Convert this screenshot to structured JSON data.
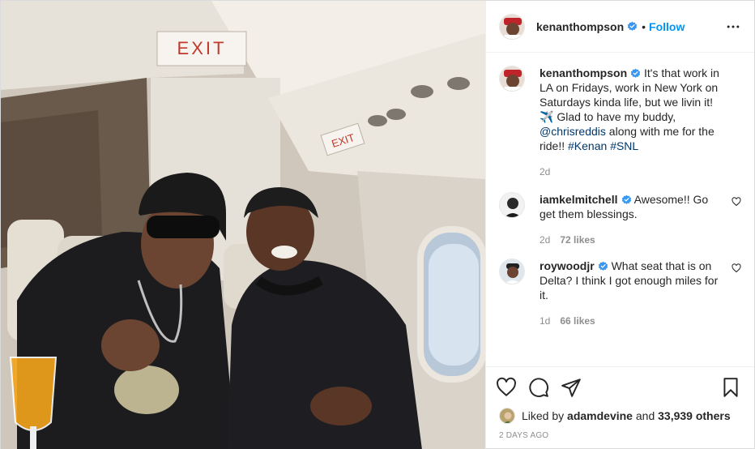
{
  "post": {
    "username": "kenanthompson",
    "follow_label": "Follow",
    "dot": "•"
  },
  "caption": {
    "username": "kenanthompson",
    "text_part1": "It's that work in LA on Fridays, work in New York on Saturdays kinda life, but we livin it! ✈️ Glad to have my buddy,",
    "mention": "@chrisreddis",
    "text_part2": "along with me for the ride!!",
    "hashtag1": "#Kenan",
    "hashtag2": "#SNL",
    "time": "2d"
  },
  "comments": [
    {
      "username": "iamkelmitchell",
      "text": "Awesome!! Go get them blessings.",
      "time": "2d",
      "likes": "72 likes"
    },
    {
      "username": "roywoodjr",
      "text": "What seat that is on Delta? I think I got enough miles for it.",
      "time": "1d",
      "likes": "66 likes"
    }
  ],
  "likes_line": {
    "prefix": "Liked by",
    "user": "adamdevine",
    "middle": "and",
    "count": "33,939 others"
  },
  "date": "2 DAYS AGO",
  "photo_signs": {
    "exit_top": "EXIT",
    "exit_side": "EXIT"
  },
  "colors": {
    "accent": "#0095f6",
    "verified": "#3897f0",
    "text": "#262626",
    "muted": "#8e8e8e"
  },
  "icons": [
    "heart-icon",
    "comment-icon",
    "share-icon",
    "bookmark-icon",
    "more-options-icon",
    "verified-badge-icon"
  ]
}
